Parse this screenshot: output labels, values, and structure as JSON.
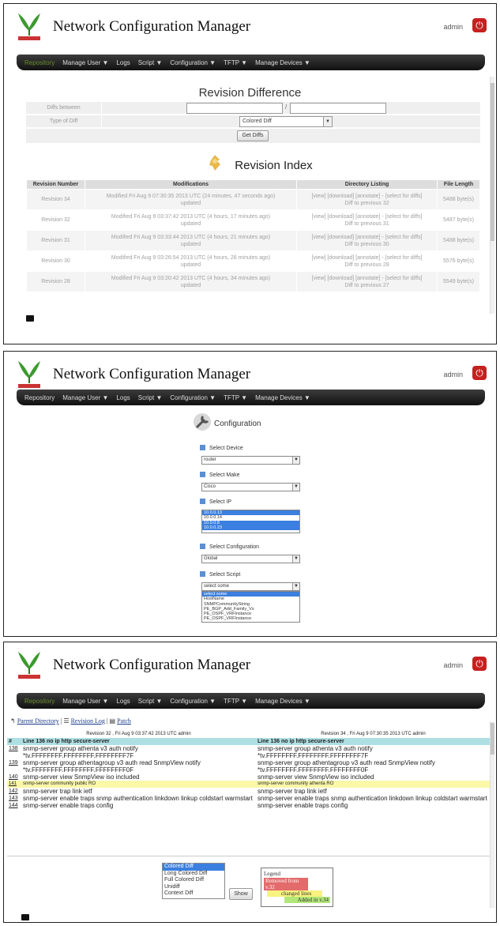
{
  "app": {
    "title": "Network Configuration Manager",
    "user": "admin"
  },
  "nav": {
    "items": [
      "Repository",
      "Manage User ▼",
      "Logs",
      "Script ▼",
      "Configuration ▼",
      "TFTP ▼",
      "Manage Devices ▼"
    ]
  },
  "panel1": {
    "heading": "Revision Difference",
    "diffs_between_label": "Diffs between",
    "type_of_diff_label": "Type of Diff",
    "type_of_diff_value": "Colored Diff",
    "get_diffs_button": "Get Diffs",
    "index_heading": "Revision Index",
    "columns": [
      "Revision Number",
      "Modifications",
      "Directory Listing",
      "File Length"
    ],
    "rows": [
      {
        "rev": "Revision 34",
        "mod1": "Modified Fri Aug 9 07:30:35 2013 UTC (24 minutes, 47 seconds ago)",
        "mod2": "updated",
        "dir1": "[view] [download] [annotate] - [select for diffs]",
        "dir2": "Diff to previous 32",
        "len": "5488 byte(s)"
      },
      {
        "rev": "Revision 32",
        "mod1": "Modified Fri Aug 9 03:37:42 2013 UTC (4 hours, 17 minutes ago)",
        "mod2": "updated",
        "dir1": "[view] [download] [annotate] - [select for diffs]",
        "dir2": "Diff to previous 31",
        "len": "5487 byte(s)"
      },
      {
        "rev": "Revision 31",
        "mod1": "Modified Fri Aug 9 03:33:44 2013 UTC (4 hours, 21 minutes ago)",
        "mod2": "updated",
        "dir1": "[view] [download] [annotate] - [select for diffs]",
        "dir2": "Diff to previous 30",
        "len": "5488 byte(s)"
      },
      {
        "rev": "Revision 30",
        "mod1": "Modified Fri Aug 9 03:26:54 2013 UTC (4 hours, 28 minutes ago)",
        "mod2": "updated",
        "dir1": "[view] [download] [annotate] - [select for diffs]",
        "dir2": "Diff to previous 28",
        "len": "5576 byte(s)"
      },
      {
        "rev": "Revision 28",
        "mod1": "Modified Fri Aug 9 03:20:42 2013 UTC (4 hours, 34 minutes ago)",
        "mod2": "updated",
        "dir1": "[view] [download] [annotate] - [select for diffs]",
        "dir2": "Diff to previous 27",
        "len": "5549 byte(s)"
      }
    ]
  },
  "panel2": {
    "heading": "Configuration",
    "device_label": "Select Device",
    "device_value": "router",
    "make_label": "Select Make",
    "make_value": "Cisco",
    "ip_label": "Select IP",
    "ip_options": [
      "10.0.0.13",
      "10.0.0.14",
      "10.0.0.8",
      "10.0.0.23"
    ],
    "configuration_label": "Select Configuration",
    "configuration_value": "Global",
    "script_label": "Select Script",
    "script_value": "select some",
    "script_options": [
      "select some",
      "HostName",
      "SNMPCommunityString",
      "PE_BGP_Add_Family_Vs",
      "PE_OSPF_VRFInstance",
      "PE_OSPF_VRFInstance"
    ]
  },
  "panel3": {
    "parent_directory": "Parent Directory",
    "revision_log": "Revision Log",
    "patch": "Patch",
    "left_header": "Revision 32 , Fri Aug 9 03:37:42 2013 UTC admin",
    "right_header": "Revision 34 , Fri Aug 9 07:30:35 2013 UTC admin",
    "hash": "#",
    "left_line": "Line 136 no ip http secure-server",
    "right_line": "Line 136 no ip http secure-server",
    "lines": [
      {
        "n": "138",
        "l": "snmp-server group athenta v3 auth notify",
        "r": "snmp-server group athenta v3 auth notify",
        "chg": false
      },
      {
        "n": "",
        "l": "*tv.FFFFFFFF.FFFFFFFF.FFFFFFFF7F",
        "r": "*tv.FFFFFFFF.FFFFFFFF.FFFFFFFF7F",
        "chg": false
      },
      {
        "n": "139",
        "l": "snmp-server group athentagroup v3 auth read SnmpView notify",
        "r": "snmp-server group athentagroup v3 auth read SnmpView notify",
        "chg": false
      },
      {
        "n": "",
        "l": "*tv.FFFFFFFF.FFFFFFFF.FFFFFFFF0F",
        "r": "*tv.FFFFFFFF.FFFFFFFF.FFFFFFFF0F",
        "chg": false
      },
      {
        "n": "140",
        "l": "snmp-server view SnmpView iso included",
        "r": "snmp-server view SnmpView iso included",
        "chg": false
      },
      {
        "n": "141",
        "l": "snmp-server community public RO",
        "r": "snmp-server community athenta RO",
        "chg": true
      },
      {
        "n": "142",
        "l": "snmp-server trap link ietf",
        "r": "snmp-server trap link ietf",
        "chg": false
      },
      {
        "n": "143",
        "l": "snmp-server enable traps snmp authentication linkdown linkup coldstart warmstart",
        "r": "snmp-server enable traps snmp authentication linkdown linkup coldstart warmstart",
        "chg": false
      },
      {
        "n": "144",
        "l": "snmp-server enable traps config",
        "r": "snmp-server enable traps config",
        "chg": false
      }
    ],
    "diff_types": [
      "Colored Diff",
      "Long Colored Diff",
      "Full Colored Diff",
      "Unidiff",
      "Context Diff"
    ],
    "show_button": "Show",
    "legend_title": "Legend",
    "legend_removed": "Removed from v.32",
    "legend_changed": "changed lines",
    "legend_added": "Added in v.34"
  },
  "colors": {
    "nav_bg": "#1a1a1a",
    "accent_blue": "#3b7fe0",
    "diff_header": "#aedfe3",
    "changed": "#fbf8a8",
    "removed": "#e36b6b",
    "added": "#b3e67a",
    "power": "#c62020"
  }
}
